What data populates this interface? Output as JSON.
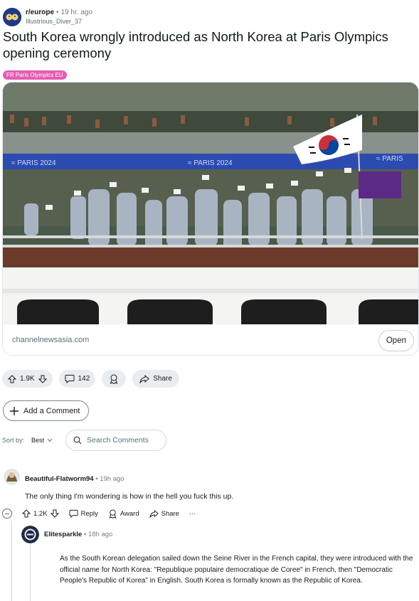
{
  "post": {
    "subreddit": "r/europe",
    "separator": "•",
    "time": "19 hr. ago",
    "author": "Illustrious_Diver_37",
    "title": "South Korea wrongly introduced as North Korea at Paris Olympics opening ceremony",
    "flair": "FR Paris Olympics EU",
    "domain": "channelnewsasia.com",
    "open_label": "Open",
    "image_alt": "Korean delegation on a boat waving South Korean flags"
  },
  "actions": {
    "upvotes": "1.9K",
    "comments": "142",
    "share_label": "Share"
  },
  "add_comment_label": "Add a Comment",
  "sort": {
    "label": "Sort by:",
    "value": "Best",
    "search_placeholder": "Search Comments"
  },
  "comments": [
    {
      "author": "Beautiful-Flatworm94",
      "time": "19h ago",
      "body": "The only thing I'm wondering is how in the hell you fuck this up.",
      "votes": "1.2K",
      "reply_label": "Reply",
      "award_label": "Award",
      "share_label": "Share",
      "more_label": "···"
    },
    {
      "author": "Elitesparkle",
      "time": "18h ago",
      "body": "As the South Korean delegation sailed down the Seine River in the French capital, they were introduced with the official name for North Korea: \"Republique populaire democratique de Coree\" in French, then \"Democratic People's Republic of Korea\" in English. South Korea is formally known as the Republic of Korea."
    }
  ],
  "icons": {
    "sub_avatar": "subreddit-icon",
    "upvote": "upvote-icon",
    "downvote": "downvote-icon",
    "comment": "comment-icon",
    "award": "award-icon",
    "share": "share-icon",
    "plus": "plus-icon",
    "search": "search-icon"
  },
  "colors": {
    "flair_bg": "#e55cb4",
    "pill_bg": "#eaedef",
    "text": "#1a1a1b",
    "muted": "#576f76"
  }
}
